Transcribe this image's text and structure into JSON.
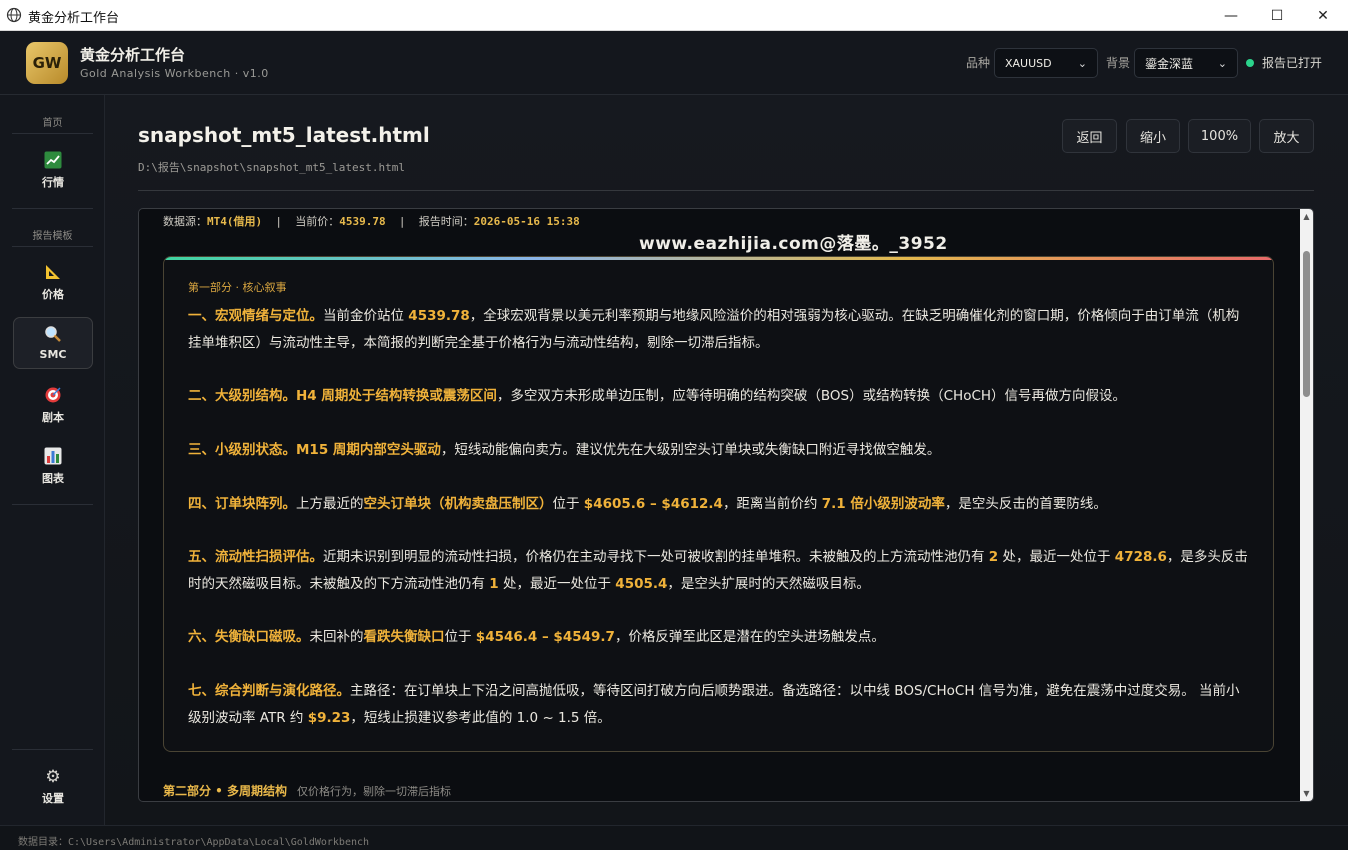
{
  "window": {
    "title": "黄金分析工作台",
    "minimize": "—",
    "maximize": "☐",
    "close": "✕"
  },
  "app": {
    "logo": "GW",
    "title": "黄金分析工作台",
    "subtitle": "Gold Analysis Workbench · v1.0"
  },
  "header": {
    "symbol_label": "品种",
    "symbol_value": "XAUUSD",
    "theme_label": "背景",
    "theme_value": "鎏金深蓝",
    "status": "报告已打开",
    "status_color": "#2bd48c"
  },
  "sidebar": {
    "section_home": "首页",
    "section_templates": "报告模板",
    "items": [
      {
        "label": "行情",
        "icon": "chart-up-icon"
      },
      {
        "label": "价格",
        "icon": "triangle-ruler-icon"
      },
      {
        "label": "SMC",
        "icon": "magnifier-icon"
      },
      {
        "label": "剧本",
        "icon": "target-icon"
      },
      {
        "label": "图表",
        "icon": "bar-chart-icon"
      }
    ],
    "settings": {
      "label": "设置",
      "icon": "gear-icon"
    }
  },
  "main": {
    "file_title": "snapshot_mt5_latest.html",
    "file_path": "D:\\报告\\snapshot\\snapshot_mt5_latest.html",
    "toolbar": {
      "back": "返回",
      "zoom_out": "缩小",
      "zoom": "100%",
      "zoom_in": "放大"
    }
  },
  "report": {
    "meta": {
      "src_label": "数据源：",
      "src_value": "MT4(借用)",
      "sep1": "  |  ",
      "price_label": "当前价：",
      "price_value": "4539.78",
      "sep2": "  |  ",
      "time_label": "报告时间：",
      "time_value": "2026-05-16 15:38"
    },
    "watermark": "www.eazhijia.com@落墨。_3952",
    "section1_label": "第一部分 · 核心叙事",
    "p1": {
      "h": "一、宏观情绪与定位。",
      "t1": "当前金价站位 ",
      "n1": "4539.78",
      "t2": "，全球宏观背景以美元利率预期与地缘风险溢价的相对强弱为核心驱动。在缺乏明确催化剂的窗口期，价格倾向于由订单流（机构挂单堆积区）与流动性主导，本简报的判断完全基于价格行为与流动性结构，剔除一切滞后指标。"
    },
    "p2": {
      "h": "二、大级别结构。H4 周期处于结构转换或震荡区间",
      "t1": "，多空双方未形成单边压制，应等待明确的结构突破（BOS）或结构转换（CHoCH）信号再做方向假设。"
    },
    "p3": {
      "h": "三、小级别状态。M15 周期内部空头驱动",
      "t1": "，短线动能偏向卖方。建议优先在大级别空头订单块或失衡缺口附近寻找做空触发。"
    },
    "p4": {
      "h": "四、订单块阵列。",
      "t1": "上方最近的",
      "h2": "空头订单块（机构卖盘压制区）",
      "t2": "位于 ",
      "n1": "$4605.6 – $4612.4",
      "t3": "，距离当前价约 ",
      "n2": "7.1 倍小级别波动率",
      "t4": "，是空头反击的首要防线。"
    },
    "p5": {
      "h": "五、流动性扫损评估。",
      "t1": "近期未识别到明显的流动性扫损，价格仍在主动寻找下一处可被收割的挂单堆积。未被触及的上方流动性池仍有 ",
      "n1": "2",
      "t2": " 处，最近一处位于 ",
      "n2": "4728.6",
      "t3": "，是多头反击时的天然磁吸目标。未被触及的下方流动性池仍有 ",
      "n3": "1",
      "t4": " 处，最近一处位于 ",
      "n4": "4505.4",
      "t5": "，是空头扩展时的天然磁吸目标。"
    },
    "p6": {
      "h": "六、失衡缺口磁吸。",
      "t1": "未回补的",
      "h2": "看跌失衡缺口",
      "t2": "位于 ",
      "n1": "$4546.4 – $4549.7",
      "t3": "，价格反弹至此区是潜在的空头进场触发点。"
    },
    "p7": {
      "h": "七、综合判断与演化路径。",
      "t1": "主路径：在订单块上下沿之间高抛低吸，等待区间打破方向后顺势跟进。备选路径：以中线 BOS/CHoCH 信号为准，避免在震荡中过度交易。 当前小级别波动率 ATR 约 ",
      "n1": "$9.23",
      "t2": "，短线止损建议参考此值的 1.0 ~ 1.5 倍。"
    },
    "part2_title": "第二部分 • 多周期结构",
    "part2_sub": "仅价格行为，剔除一切滞后指标"
  },
  "footer": {
    "label": "数据目录：",
    "path": "C:\\Users\\Administrator\\AppData\\Local\\GoldWorkbench"
  }
}
